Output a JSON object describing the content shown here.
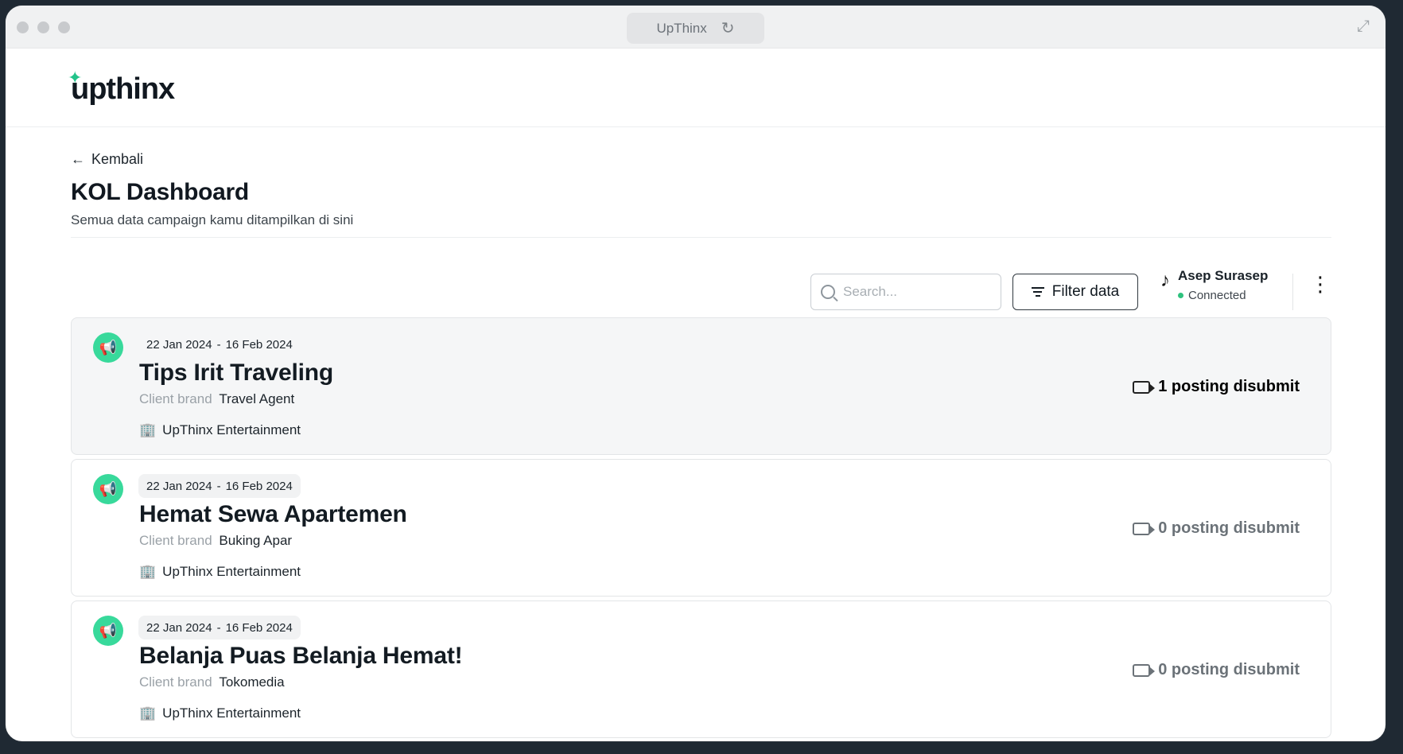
{
  "browser": {
    "tab_title": "UpThinx",
    "reload_icon": "reload-icon",
    "expand_icon": "expand-icon"
  },
  "header": {
    "logo_text": "upthinx"
  },
  "page": {
    "back_label": "Kembali",
    "title": "KOL Dashboard",
    "subtitle": "Semua data campaign kamu ditampilkan di sini"
  },
  "toolbar": {
    "search_placeholder": "Search...",
    "filter_label": "Filter data"
  },
  "account": {
    "name": "Asep Surasep",
    "status": "Connected",
    "status_color": "#2ec27e"
  },
  "colors": {
    "accent": "#38d99b",
    "logo_star": "#22c38a"
  },
  "campaigns": [
    {
      "start": "22 Jan 2024",
      "end": "16 Feb 2024",
      "title": "Tips Irit Traveling",
      "brand_label": "Client brand",
      "brand": "Travel Agent",
      "agency": "UpThinx Entertainment",
      "posts": "1 posting disubmit"
    },
    {
      "start": "22 Jan 2024",
      "end": "16 Feb 2024",
      "title": "Hemat Sewa Apartemen",
      "brand_label": "Client brand",
      "brand": "Buking Apar",
      "agency": "UpThinx Entertainment",
      "posts": "0 posting disubmit"
    },
    {
      "start": "22 Jan 2024",
      "end": "16 Feb 2024",
      "title": "Belanja Puas Belanja Hemat!",
      "brand_label": "Client brand",
      "brand": "Tokomedia",
      "agency": "UpThinx Entertainment",
      "posts": "0 posting disubmit"
    }
  ]
}
